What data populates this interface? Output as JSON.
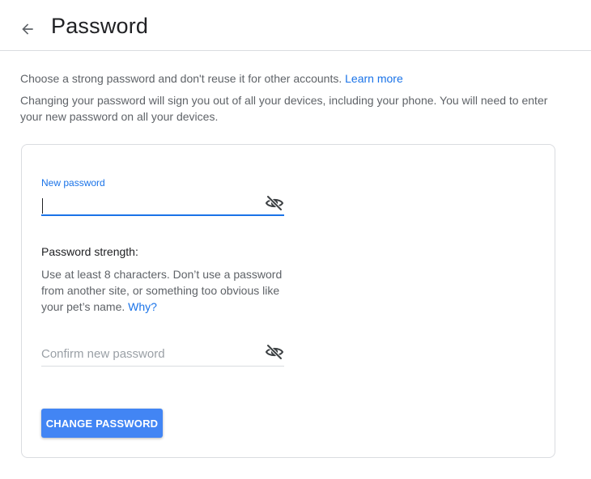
{
  "header": {
    "back_icon": "arrow-back-icon",
    "title": "Password"
  },
  "intro": {
    "line1": "Choose a strong password and don't reuse it for other accounts.",
    "learn_more": "Learn more",
    "line2": "Changing your password will sign you out of all your devices, including your phone. You will need to enter your new password on all your devices."
  },
  "form": {
    "new_password": {
      "label": "New password",
      "value": "",
      "visibility_icon": "eye-off-icon"
    },
    "strength": {
      "title": "Password strength:",
      "description": "Use at least 8 characters. Don’t use a password from another site, or something too obvious like your pet’s name.",
      "why_link": "Why?"
    },
    "confirm_password": {
      "placeholder": "Confirm new password",
      "value": "",
      "visibility_icon": "eye-off-icon"
    },
    "submit_label": "CHANGE PASSWORD"
  },
  "colors": {
    "accent": "#1a73e8",
    "button": "#4285f4",
    "text_secondary": "#5f6368",
    "border": "#dadce0"
  }
}
